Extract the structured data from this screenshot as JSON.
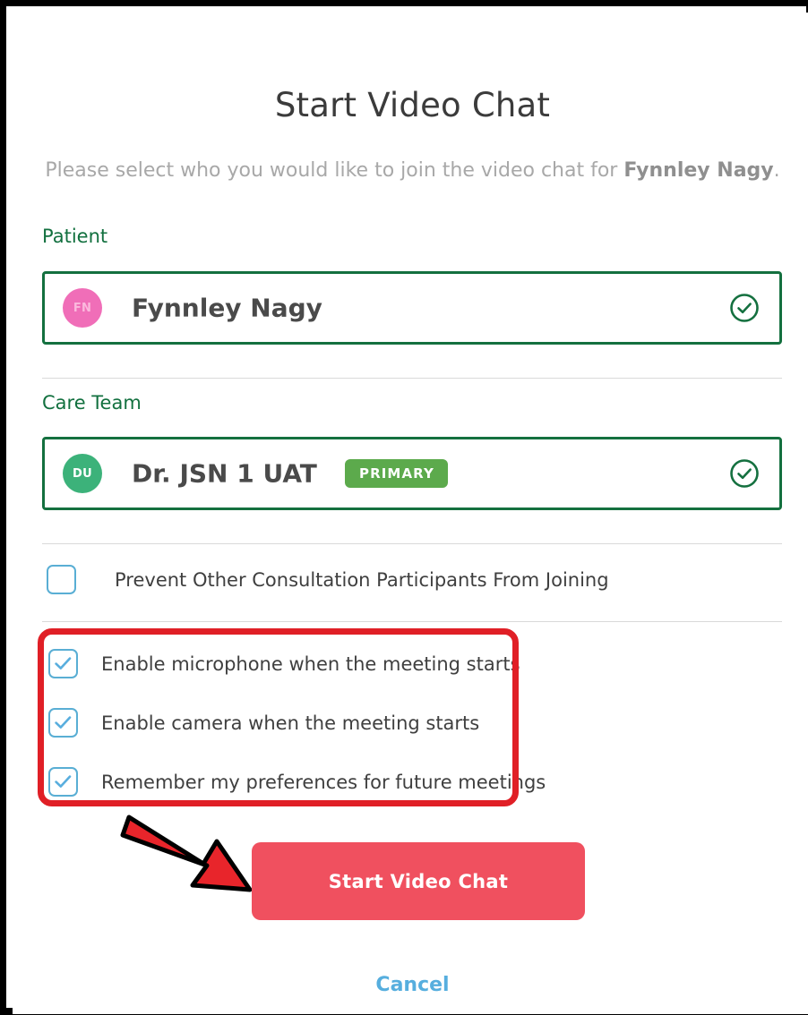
{
  "dialog": {
    "title": "Start Video Chat",
    "subtitle_prefix": "Please select who you would like to join the video chat for ",
    "subtitle_patient": "Fynnley Nagy",
    "subtitle_suffix": "."
  },
  "patient_section": {
    "label": "Patient",
    "avatar_initials": "FN",
    "name": "Fynnley Nagy",
    "selected": true,
    "avatar_color": "#f06eb8",
    "border_color": "#14703f"
  },
  "care_team_section": {
    "label": "Care Team",
    "avatar_initials": "DU",
    "name": "Dr. JSN 1 UAT",
    "badge": "PRIMARY",
    "badge_color": "#5caa4c",
    "selected": true,
    "avatar_color": "#3cb27a",
    "border_color": "#14703f"
  },
  "options": {
    "prevent": {
      "label": "Prevent Other Consultation Participants From Joining",
      "checked": false
    },
    "microphone": {
      "label": "Enable microphone when the meeting starts",
      "checked": true
    },
    "camera": {
      "label": "Enable camera when the meeting starts",
      "checked": true
    },
    "remember": {
      "label": "Remember my preferences for future meetings",
      "checked": true
    },
    "checkbox_color": "#59aede"
  },
  "actions": {
    "primary_label": "Start Video Chat",
    "primary_color": "#f0505f",
    "cancel_label": "Cancel",
    "cancel_color": "#56aede"
  },
  "annotations": {
    "highlight_color": "#e01f26",
    "arrow_color": "#e8252b"
  }
}
